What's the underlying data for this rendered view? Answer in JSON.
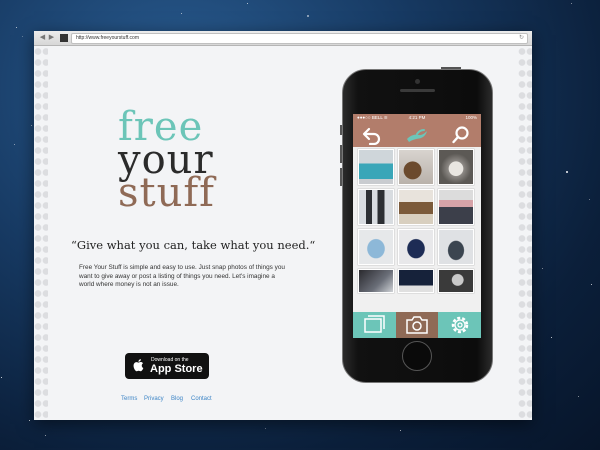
{
  "browser": {
    "url": "http://www.freeyourstuff.com"
  },
  "hero": {
    "logo_line1": "free",
    "logo_line2": "your",
    "logo_line3": "stuff",
    "tagline": "“Give what you can, take what you need.“",
    "description": "Free Your Stuff is simple and easy to use. Just snap photos of things you want to give away or post a listing of things you need. Let's imagine a world where money is not an issue."
  },
  "appstore": {
    "small_label": "Download on the",
    "big_label": "App Store"
  },
  "footer": {
    "links": [
      "Terms",
      "Privacy",
      "Blog",
      "Contact"
    ]
  },
  "phone": {
    "status": {
      "carrier": "●●●○○ BELL ≋",
      "time": "4:21 PM",
      "battery": "100%"
    },
    "appbar_icons": [
      "back-arrow-icon",
      "hand-wave-icon",
      "search-icon"
    ],
    "tabbar_icons": [
      "gallery-icon",
      "camera-icon",
      "settings-gear-icon"
    ],
    "active_tab": "camera-icon"
  },
  "colors": {
    "teal": "#6cc5b8",
    "brown": "#b27d6b",
    "dark_brown": "#8f6a56",
    "text_dark": "#2b2b2b",
    "link_blue": "#3d85c6"
  }
}
